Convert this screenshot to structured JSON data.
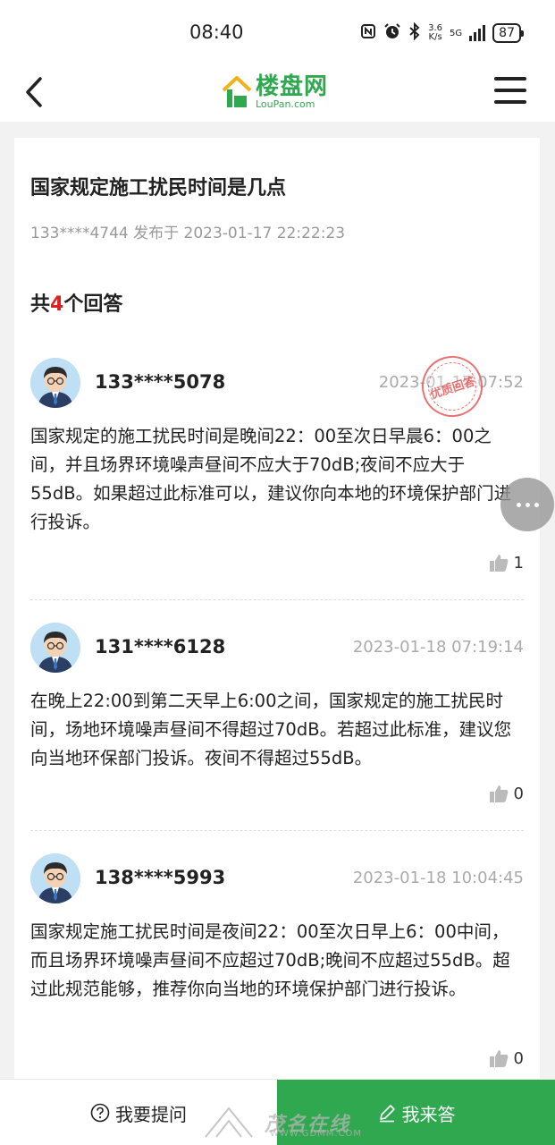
{
  "status_bar": {
    "time": "08:40",
    "net_speed_value": "3.6",
    "net_speed_unit": "K/s",
    "network": "5G",
    "battery": "87",
    "icons": [
      "nfc-icon",
      "alarm-icon",
      "bluetooth-icon",
      "signal-icon",
      "battery-icon"
    ]
  },
  "header": {
    "back_icon": "chevron-left-icon",
    "logo_cn": "楼盘网",
    "logo_en": "LouPan.com",
    "menu_icon": "hamburger-menu-icon"
  },
  "question": {
    "title": "国家规定施工扰民时间是几点",
    "author": "133****4744",
    "published_label": "发布于",
    "published_time": "2023-01-17 22:22:23"
  },
  "answers_summary": {
    "prefix": "共",
    "count": "4",
    "suffix": "个回答"
  },
  "answers": [
    {
      "user": "133****5078",
      "time": "2023-01-17 07:52",
      "content": "国家规定的施工扰民时间是晚间22：00至次日早晨6：00之间，并且场界环境噪声昼间不应大于70dB;夜间不应大于55dB。如果超过此标准可以，建议你向本地的环境保护部门进行投诉。",
      "likes": "1",
      "badge": "优质回答"
    },
    {
      "user": "131****6128",
      "time": "2023-01-18 07:19:14",
      "content": "在晚上22:00到第二天早上6:00之间，国家规定的施工扰民时间，场地环境噪声昼间不得超过70dB。若超过此标准，建议您向当地环保部门投诉。夜间不得超过55dB。",
      "likes": "0"
    },
    {
      "user": "138****5993",
      "time": "2023-01-18 10:04:45",
      "content": "国家规定施工扰民时间是夜间22：00至次日早上6：00中间，而且场界环境噪声昼间不应超过70dB;晚间不应超过55dB。超过此规范能够，推荐你向当地的环境保护部门进行投诉。",
      "likes": "0"
    }
  ],
  "bottom_bar": {
    "ask_label": "我要提问",
    "answer_label": "我来答",
    "ask_icon": "question-circle-icon",
    "answer_icon": "pencil-icon"
  },
  "watermark": {
    "text": "茂名在线",
    "url": "WWW.GDMM.COM"
  },
  "colors": {
    "brand_green": "#2fa84f",
    "count_red": "#e02020",
    "stamp_red": "#e65a5a"
  }
}
